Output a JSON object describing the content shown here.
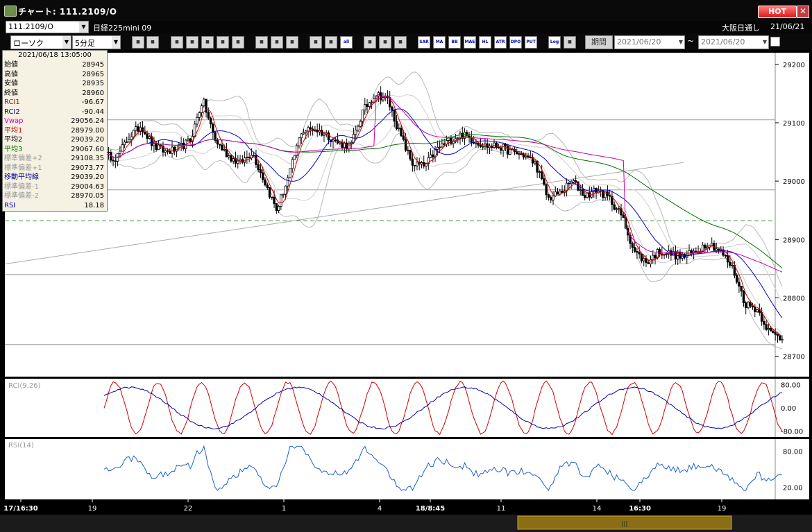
{
  "window": {
    "title": "チャート: 111.2109/O",
    "hot_label": "HOT",
    "close_glyph": "✕"
  },
  "infobar": {
    "symbol": "111.2109/O",
    "instrument": "日経225mini 09",
    "session": "大阪日通し",
    "date": "21/06/21"
  },
  "toolbar": {
    "chart_type": "ローソク",
    "timeframe": "5分足",
    "period_label": "期間",
    "date_from": "2021/06/20",
    "date_to": "2021/06/20",
    "tilde": "~",
    "buttons": [
      "zoom-icon",
      "grid-icon",
      "candle-icon",
      "pnf-icon",
      "volume-icon",
      "split-icon",
      "eraser-icon",
      "pen-icon",
      "cursor-icon",
      "draw-icon",
      "box-icon",
      "box2-icon",
      "all",
      "settings-icon",
      "edit-icon",
      "color-icon",
      "SAR",
      "MA",
      "BB",
      "MAE",
      "HL",
      "ATR",
      "DPO",
      "PUT",
      "Log",
      "export-icon"
    ]
  },
  "datapanel": {
    "time": "2021/06/18  13:05:00",
    "rows": [
      {
        "k": "始値",
        "v": "28945",
        "color": "#000000"
      },
      {
        "k": "高値",
        "v": "28965",
        "color": "#000000"
      },
      {
        "k": "安値",
        "v": "28935",
        "color": "#000000"
      },
      {
        "k": "終値",
        "v": "28960",
        "color": "#000000"
      },
      {
        "k": "RCI1",
        "v": "-96.67",
        "color": "#d00000"
      },
      {
        "k": "RCI2",
        "v": "-90.44",
        "color": "#00008b"
      },
      {
        "k": "Vwap",
        "v": "29056.24",
        "color": "#cc00aa"
      },
      {
        "k": "平均1",
        "v": "28979.00",
        "color": "#d00000"
      },
      {
        "k": "平均2",
        "v": "29039.20",
        "color": "#000000"
      },
      {
        "k": "平均3",
        "v": "29067.60",
        "color": "#007000"
      },
      {
        "k": "標準偏差+2",
        "v": "29108.35",
        "color": "#999999"
      },
      {
        "k": "標準偏差+1",
        "v": "29073.77",
        "color": "#999999"
      },
      {
        "k": "移動平均線",
        "v": "29039.20",
        "color": "#00008b"
      },
      {
        "k": "標準偏差-1",
        "v": "29004.63",
        "color": "#999999"
      },
      {
        "k": "標準偏差-2",
        "v": "28970.05",
        "color": "#999999"
      },
      {
        "k": "RSI",
        "v": "18.18",
        "color": "#0000cc"
      }
    ]
  },
  "chart_data": [
    {
      "type": "candlestick",
      "panel": "price",
      "y_ticks": [
        "29200",
        "29100",
        "29000",
        "28900",
        "28800",
        "28700"
      ],
      "ylim": [
        28665,
        29220
      ],
      "x_ticks": [
        {
          "label": "17/16:30",
          "bold": true
        },
        {
          "label": "19",
          "bold": false
        },
        {
          "label": "22",
          "bold": false
        },
        {
          "label": "1",
          "bold": false
        },
        {
          "label": "4",
          "bold": false
        },
        {
          "label": "18/8:45",
          "bold": true
        },
        {
          "label": "11",
          "bold": false
        },
        {
          "label": "14",
          "bold": false
        },
        {
          "label": "16:30",
          "bold": true
        },
        {
          "label": "19",
          "bold": false
        }
      ],
      "close_waypoints": [
        29045,
        29040,
        29075,
        29095,
        29060,
        29050,
        29055,
        29070,
        29140,
        29070,
        29045,
        29030,
        29050,
        29000,
        28950,
        29010,
        29085,
        29090,
        29080,
        29065,
        29060,
        29120,
        29150,
        29140,
        29080,
        29030,
        29025,
        29055,
        29070,
        29080,
        29070,
        29060,
        29060,
        29050,
        29045,
        29030,
        28970,
        28980,
        29000,
        28975,
        28985,
        28970,
        28940,
        28880,
        28860,
        28880,
        28875,
        28870,
        28880,
        28895,
        28880,
        28850,
        28790,
        28780,
        28740,
        28730
      ],
      "horizontal_lines": [
        29105,
        28985,
        28840,
        28720
      ],
      "dashed_line": 28932,
      "series": [
        {
          "name": "平均1",
          "color": "#d00000"
        },
        {
          "name": "移動平均線",
          "color": "#0000cc"
        },
        {
          "name": "平均3",
          "color": "#007000"
        },
        {
          "name": "Vwap",
          "color": "#cc00aa"
        }
      ]
    },
    {
      "type": "line",
      "panel": "rci",
      "title": "RCI(9,26)",
      "y_ticks": [
        "80.00",
        "0.00",
        "-80.00"
      ],
      "ylim": [
        -100,
        100
      ]
    },
    {
      "type": "line",
      "panel": "rsi",
      "title": "RSI(14)",
      "y_ticks": [
        "80.00",
        "20.00"
      ],
      "ylim": [
        0,
        100
      ]
    }
  ]
}
